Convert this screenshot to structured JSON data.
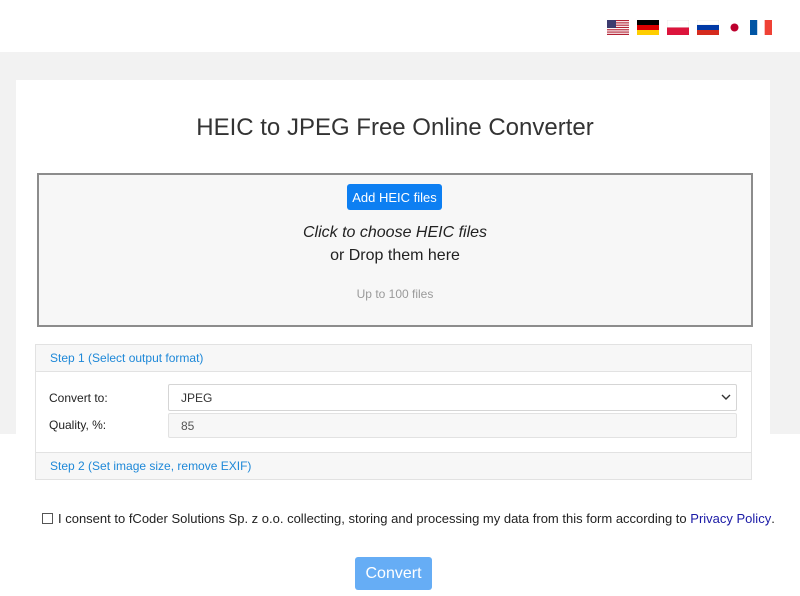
{
  "header": {
    "languages": [
      {
        "code": "en",
        "icon": "us-flag-icon"
      },
      {
        "code": "de",
        "icon": "de-flag-icon"
      },
      {
        "code": "pl",
        "icon": "pl-flag-icon"
      },
      {
        "code": "ru",
        "icon": "ru-flag-icon"
      },
      {
        "code": "ja",
        "icon": "jp-flag-icon"
      },
      {
        "code": "fr",
        "icon": "fr-flag-icon"
      }
    ]
  },
  "main": {
    "title": "HEIC to JPEG Free Online Converter",
    "dropzone": {
      "add_button": "Add HEIC files",
      "click_text": "Click to choose HEIC files",
      "drop_text": "or Drop them here",
      "limit_text": "Up to 100 files"
    },
    "step1": {
      "label": "Step 1 (Select output format)",
      "convert_to_label": "Convert to:",
      "convert_to_value": "JPEG",
      "quality_label": "Quality, %:",
      "quality_value": "85"
    },
    "step2": {
      "label": "Step 2 (Set image size, remove EXIF)"
    },
    "consent": {
      "text": "I consent to fCoder Solutions Sp. z o.o. collecting, storing and processing my data from this form according to",
      "link": "Privacy Policy",
      "suffix": "."
    },
    "convert_button": "Convert"
  },
  "colors": {
    "accent": "#0d7ff2",
    "convert_button": "#66adf5",
    "step_label": "#1e88d8",
    "link": "#1a1aa6"
  }
}
